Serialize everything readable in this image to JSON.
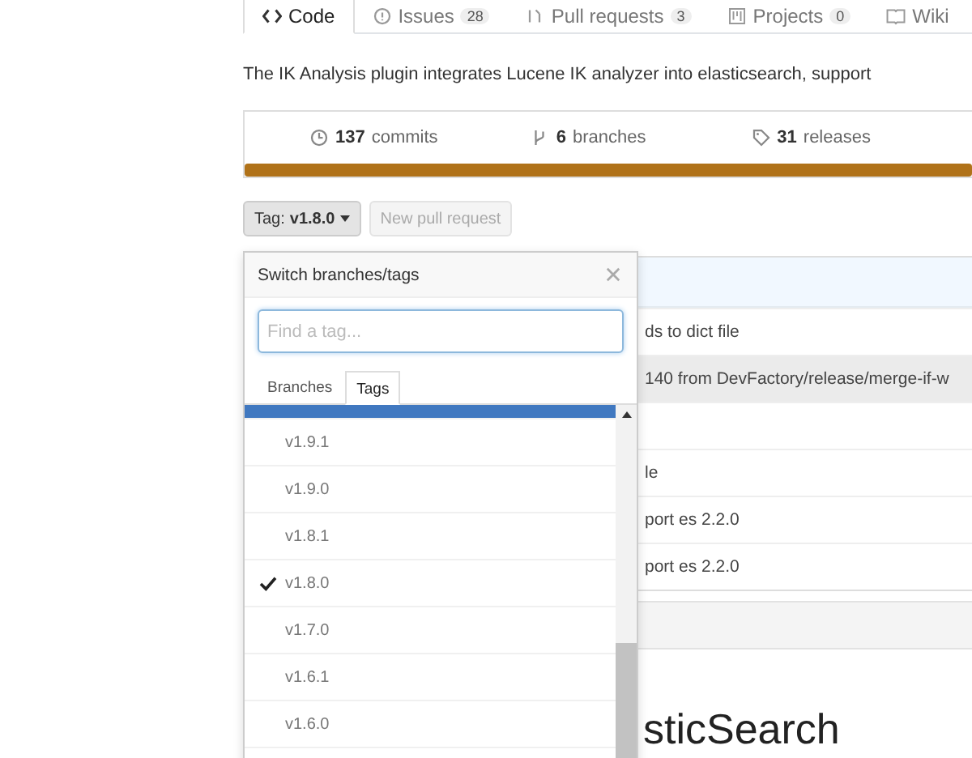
{
  "tabs": [
    {
      "label": "Code",
      "selected": true
    },
    {
      "label": "Issues",
      "count": "28",
      "selected": false
    },
    {
      "label": "Pull requests",
      "count": "3",
      "selected": false
    },
    {
      "label": "Projects",
      "count": "0",
      "selected": false
    },
    {
      "label": "Wiki",
      "selected": false
    }
  ],
  "description": "The IK Analysis plugin integrates Lucene IK analyzer into elasticsearch, support",
  "stats": [
    {
      "number": "137",
      "label": "commits"
    },
    {
      "number": "6",
      "label": "branches"
    },
    {
      "number": "31",
      "label": "releases"
    }
  ],
  "branch_button": {
    "prefix": "Tag:",
    "value": "v1.8.0"
  },
  "new_pull_request": "New pull request",
  "files": [
    {
      "kind": "header"
    },
    {
      "kind": "row",
      "text": "ds to dict file",
      "highlighted": false
    },
    {
      "kind": "row",
      "text": "140 from DevFactory/release/merge-if-w",
      "highlighted": true
    },
    {
      "kind": "row",
      "highlighted": false
    },
    {
      "kind": "row",
      "text": "le",
      "highlighted": false
    },
    {
      "kind": "row",
      "text": "port es 2.2.0",
      "highlighted": false
    },
    {
      "kind": "row",
      "text": "port es 2.2.0",
      "highlighted": false
    }
  ],
  "readme_heading": "sticSearch",
  "dropdown": {
    "title": "Switch branches/tags",
    "placeholder": "Find a tag...",
    "tabs": [
      {
        "label": "Branches",
        "selected": false
      },
      {
        "label": "Tags",
        "selected": true
      }
    ],
    "items": [
      {
        "selected": true
      },
      {
        "label": "v1.9.1",
        "selected": false,
        "checked": false
      },
      {
        "label": "v1.9.0",
        "selected": false,
        "checked": false
      },
      {
        "label": "v1.8.1",
        "selected": false,
        "checked": false
      },
      {
        "label": "v1.8.0",
        "selected": false,
        "checked": true
      },
      {
        "label": "v1.7.0",
        "selected": false,
        "checked": false
      },
      {
        "label": "v1.6.1",
        "selected": false,
        "checked": false
      },
      {
        "label": "v1.6.0",
        "selected": false,
        "checked": false
      },
      {
        "selected": false
      }
    ]
  }
}
